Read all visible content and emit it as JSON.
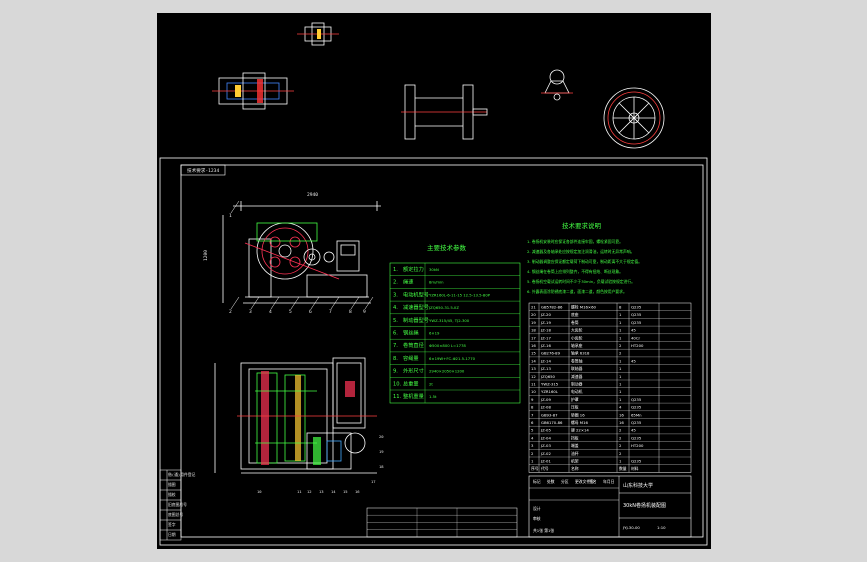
{
  "drawing": {
    "frame_label": "技术要求-1234",
    "params_title": "主要技术参数",
    "params": [
      {
        "no": "1.",
        "name": "额定拉力",
        "value": "30kN"
      },
      {
        "no": "2.",
        "name": "绳速",
        "value": "8m/min"
      },
      {
        "no": "3.",
        "name": "电动机型号",
        "value": "YZR160L-6-11-15 12.5-13.5-80P"
      },
      {
        "no": "4.",
        "name": "减速器型号",
        "value": "JZQ650-31.5-IIZ"
      },
      {
        "no": "5.",
        "name": "制动器型号",
        "value": "YWZ-315/45, TJ2-300"
      },
      {
        "no": "6.",
        "name": "钢丝绳",
        "value": "6×19"
      },
      {
        "no": "7.",
        "name": "卷筒直径",
        "value": "Φ500×800 L=1778"
      },
      {
        "no": "8.",
        "name": "容绳量",
        "value": "6×19W+FC-Φ21.5-1770"
      },
      {
        "no": "9.",
        "name": "外形尺寸",
        "value": "2940×2050×1200"
      },
      {
        "no": "10.",
        "name": "总重量",
        "value": "2t"
      },
      {
        "no": "11.",
        "name": "整机重量",
        "value": "1.5t"
      }
    ],
    "tech_title": "技术要求说明",
    "tech_notes": [
      "1. 卷扬机安装时应保证各部件连接牢固，螺栓紧固可靠。",
      "2. 减速器及各轴承处应按规定加注润滑油，运转时无异常声响。",
      "3. 制动器调整应保证额定载荷下制动可靠，制动距离不大于规定值。",
      "4. 钢丝绳在卷筒上应排列整齐，不得有扭结、断丝现象。",
      "5. 卷扬机空载试运转时间不少于30min，负载试验按规定进行。",
      "6. 外露表面涂防锈底漆二道，面漆二道，颜色按用户要求。"
    ],
    "callouts_top": [
      "1",
      "2",
      "3",
      "4",
      "5",
      "6",
      "7",
      "8",
      "9"
    ],
    "callouts_bottom": [
      "10",
      "11",
      "12",
      "13",
      "14",
      "15",
      "16",
      "17",
      "18",
      "19",
      "20"
    ],
    "dim_overall": "2940",
    "dim_height": "1200",
    "bom_rows": [
      {
        "no": "21",
        "code": "GB5782-86",
        "name": "螺栓 M16×60",
        "qty": "8",
        "mat": "Q235"
      },
      {
        "no": "20",
        "code": "JZ-20",
        "name": "底座",
        "qty": "1",
        "mat": "Q235"
      },
      {
        "no": "19",
        "code": "JZ-19",
        "name": "卷筒",
        "qty": "1",
        "mat": "Q235"
      },
      {
        "no": "18",
        "code": "JZ-18",
        "name": "大齿轮",
        "qty": "1",
        "mat": "45"
      },
      {
        "no": "17",
        "code": "JZ-17",
        "name": "小齿轮",
        "qty": "1",
        "mat": "40Cr"
      },
      {
        "no": "16",
        "code": "JZ-16",
        "name": "轴承座",
        "qty": "2",
        "mat": "HT200"
      },
      {
        "no": "15",
        "code": "GB276-89",
        "name": "轴承 6318",
        "qty": "2",
        "mat": ""
      },
      {
        "no": "14",
        "code": "JZ-14",
        "name": "卷筒轴",
        "qty": "1",
        "mat": "45"
      },
      {
        "no": "13",
        "code": "JZ-13",
        "name": "联轴器",
        "qty": "1",
        "mat": ""
      },
      {
        "no": "12",
        "code": "JZQ650",
        "name": "减速器",
        "qty": "1",
        "mat": ""
      },
      {
        "no": "11",
        "code": "YWZ-315",
        "name": "制动器",
        "qty": "1",
        "mat": ""
      },
      {
        "no": "10",
        "code": "YZR160L",
        "name": "电动机",
        "qty": "1",
        "mat": ""
      },
      {
        "no": "9",
        "code": "JZ-09",
        "name": "护罩",
        "qty": "1",
        "mat": "Q235"
      },
      {
        "no": "8",
        "code": "JZ-08",
        "name": "压板",
        "qty": "4",
        "mat": "Q235"
      },
      {
        "no": "7",
        "code": "GB93-87",
        "name": "垫圈 16",
        "qty": "16",
        "mat": "65Mn"
      },
      {
        "no": "6",
        "code": "GB6170-86",
        "name": "螺母 M16",
        "qty": "16",
        "mat": "Q235"
      },
      {
        "no": "5",
        "code": "JZ-05",
        "name": "键 22×14",
        "qty": "2",
        "mat": "45"
      },
      {
        "no": "4",
        "code": "JZ-04",
        "name": "挡板",
        "qty": "2",
        "mat": "Q235"
      },
      {
        "no": "3",
        "code": "JZ-03",
        "name": "端盖",
        "qty": "2",
        "mat": "HT200"
      },
      {
        "no": "2",
        "code": "JZ-02",
        "name": "油杯",
        "qty": "2",
        "mat": ""
      },
      {
        "no": "1",
        "code": "JZ-01",
        "name": "机架",
        "qty": "1",
        "mat": "Q235"
      }
    ],
    "bom_header": {
      "no": "序号",
      "code": "代号",
      "name": "名称",
      "qty": "数量",
      "mat": "材料"
    },
    "title_block": {
      "company": "山东科技大学",
      "drawing_name": "30kN卷扬机装配图",
      "drawing_no": "JYJ-30-00",
      "scale": "1:10",
      "sheet": "共1张 第1张",
      "designer": "设计",
      "checker": "审核"
    },
    "left_strip": [
      "借(通)用件登记",
      "描图",
      "描校",
      "旧底图总号",
      "底图总号",
      "签字",
      "日期"
    ],
    "rev_rows": [
      "标记",
      "处数",
      "分区",
      "更改文件号",
      "签名",
      "年月日"
    ]
  }
}
